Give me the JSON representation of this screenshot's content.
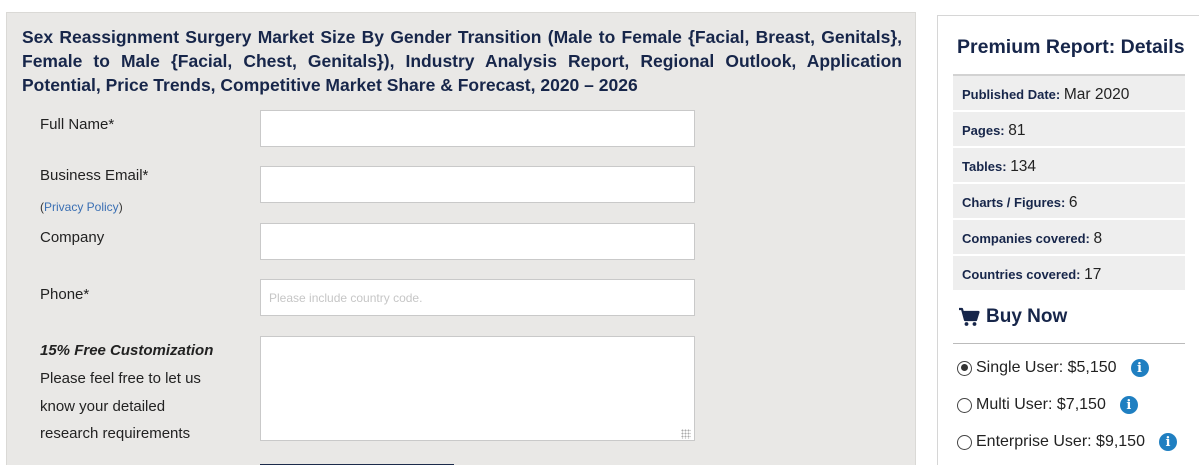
{
  "form": {
    "title": "Sex Reassignment Surgery Market Size By Gender Transition (Male to Female {Facial, Breast, Genitals}, Female to Male {Facial, Chest, Genitals}), Industry Analysis Report, Regional Outlook, Application Potential, Price Trends, Competitive Market Share & Forecast, 2020 – 2026",
    "full_name_label": "Full Name*",
    "full_name_value": "",
    "email_label": "Business Email*",
    "email_value": "",
    "privacy_open": "(",
    "privacy_link": "Privacy Policy",
    "privacy_close": ")",
    "company_label": "Company",
    "company_value": "",
    "phone_label": "Phone*",
    "phone_placeholder": "Please include country code.",
    "customization_title": "15% Free Customization",
    "customization_lines": [
      "Please feel free to let us",
      "know your detailed",
      "research requirements"
    ],
    "requirements_value": ""
  },
  "sidebar": {
    "title": "Premium Report: Details",
    "details": [
      {
        "label": "Published Date:",
        "value": "Mar 2020"
      },
      {
        "label": "Pages:",
        "value": "81"
      },
      {
        "label": "Tables:",
        "value": "134"
      },
      {
        "label": "Charts / Figures:",
        "value": "6"
      },
      {
        "label": "Companies covered:",
        "value": "8"
      },
      {
        "label": "Countries covered:",
        "value": "17"
      }
    ],
    "buy_now": "Buy Now",
    "options": [
      {
        "label": "Single User: $5,150",
        "selected": true
      },
      {
        "label": "Multi User: $7,150",
        "selected": false
      },
      {
        "label": "Enterprise User: $9,150",
        "selected": false
      }
    ]
  },
  "colors": {
    "navy": "#17264a",
    "panel_bg": "#e9e8e6",
    "info_blue": "#1f7fc1",
    "link_blue": "#3a6fb3"
  },
  "icons": [
    "cart-icon",
    "info-icon"
  ]
}
